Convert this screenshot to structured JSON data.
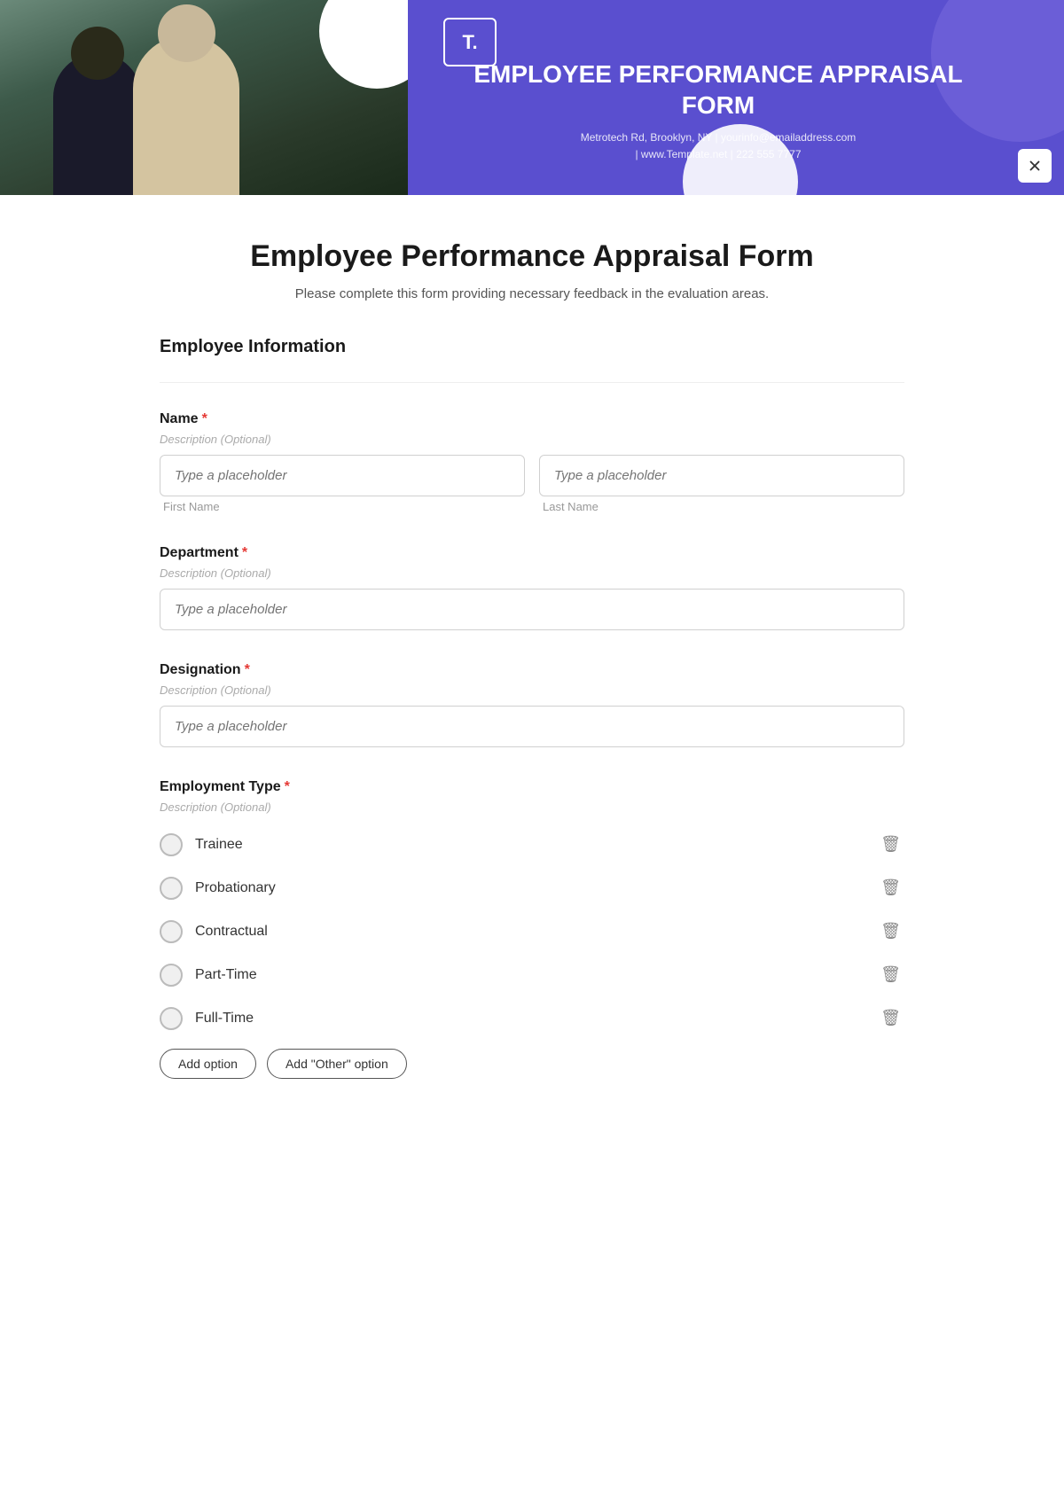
{
  "header": {
    "logo_text": "T.",
    "title": "EMPLOYEE PERFORMANCE APPRAISAL FORM",
    "address_line1": "Metrotech Rd, Brooklyn, NY  |  yourinfo@emailaddress.com",
    "address_line2": "| www.Template.net  |  222 555 7777",
    "close_label_top": "×",
    "close_label_banner": "×"
  },
  "form": {
    "title": "Employee Performance Appraisal Form",
    "subtitle": "Please complete this form providing necessary feedback in the evaluation areas.",
    "section_employee_info": "Employee Information",
    "fields": {
      "name": {
        "label": "Name",
        "required": true,
        "description": "Description (Optional)",
        "first_placeholder": "Type a placeholder",
        "last_placeholder": "Type a placeholder",
        "first_sublabel": "First Name",
        "last_sublabel": "Last Name"
      },
      "department": {
        "label": "Department",
        "required": true,
        "description": "Description (Optional)",
        "placeholder": "Type a placeholder"
      },
      "designation": {
        "label": "Designation",
        "required": true,
        "description": "Description (Optional)",
        "placeholder": "Type a placeholder"
      },
      "employment_type": {
        "label": "Employment Type",
        "required": true,
        "description": "Description (Optional)",
        "options": [
          {
            "label": "Trainee"
          },
          {
            "label": "Probationary"
          },
          {
            "label": "Contractual"
          },
          {
            "label": "Part-Time"
          },
          {
            "label": "Full-Time"
          }
        ],
        "add_option_btn": "Add option",
        "add_other_btn": "Add \"Other\" option"
      }
    }
  },
  "icons": {
    "delete": "🗑",
    "close_x": "✕"
  }
}
